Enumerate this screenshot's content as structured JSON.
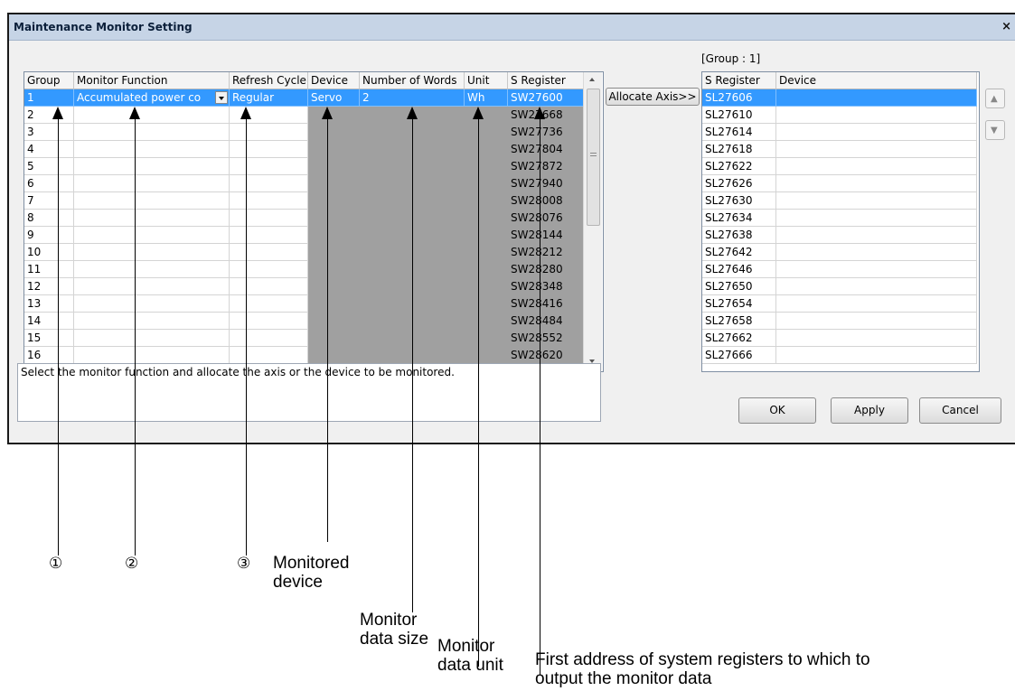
{
  "window": {
    "title": "Maintenance Monitor Setting",
    "close": "×"
  },
  "left_grid": {
    "headers": [
      "Group",
      "Monitor Function",
      "Refresh Cycle",
      "Device",
      "Number of Words",
      "Unit",
      "S Register"
    ],
    "rows": [
      [
        "1",
        "Accumulated power co",
        "Regular",
        "Servo",
        "2",
        "Wh",
        "SW27600"
      ],
      [
        "2",
        "",
        "",
        "",
        "",
        "",
        "SW27668"
      ],
      [
        "3",
        "",
        "",
        "",
        "",
        "",
        "SW27736"
      ],
      [
        "4",
        "",
        "",
        "",
        "",
        "",
        "SW27804"
      ],
      [
        "5",
        "",
        "",
        "",
        "",
        "",
        "SW27872"
      ],
      [
        "6",
        "",
        "",
        "",
        "",
        "",
        "SW27940"
      ],
      [
        "7",
        "",
        "",
        "",
        "",
        "",
        "SW28008"
      ],
      [
        "8",
        "",
        "",
        "",
        "",
        "",
        "SW28076"
      ],
      [
        "9",
        "",
        "",
        "",
        "",
        "",
        "SW28144"
      ],
      [
        "10",
        "",
        "",
        "",
        "",
        "",
        "SW28212"
      ],
      [
        "11",
        "",
        "",
        "",
        "",
        "",
        "SW28280"
      ],
      [
        "12",
        "",
        "",
        "",
        "",
        "",
        "SW28348"
      ],
      [
        "13",
        "",
        "",
        "",
        "",
        "",
        "SW28416"
      ],
      [
        "14",
        "",
        "",
        "",
        "",
        "",
        "SW28484"
      ],
      [
        "15",
        "",
        "",
        "",
        "",
        "",
        "SW28552"
      ],
      [
        "16",
        "",
        "",
        "",
        "",
        "",
        "SW28620"
      ]
    ]
  },
  "allocate_button": "Allocate Axis>>",
  "group_label": "[Group : 1]",
  "right_grid": {
    "headers": [
      "S Register",
      "Device"
    ],
    "rows": [
      [
        "SL27606",
        ""
      ],
      [
        "SL27610",
        ""
      ],
      [
        "SL27614",
        ""
      ],
      [
        "SL27618",
        ""
      ],
      [
        "SL27622",
        ""
      ],
      [
        "SL27626",
        ""
      ],
      [
        "SL27630",
        ""
      ],
      [
        "SL27634",
        ""
      ],
      [
        "SL27638",
        ""
      ],
      [
        "SL27642",
        ""
      ],
      [
        "SL27646",
        ""
      ],
      [
        "SL27650",
        ""
      ],
      [
        "SL27654",
        ""
      ],
      [
        "SL27658",
        ""
      ],
      [
        "SL27662",
        ""
      ],
      [
        "SL27666",
        ""
      ]
    ]
  },
  "move_up_icon": "move-up-icon",
  "move_down_icon": "move-down-icon",
  "description": "Select the monitor function and allocate the axis or the device to be monitored.",
  "buttons": {
    "ok": "OK",
    "apply": "Apply",
    "cancel": "Cancel"
  },
  "callouts": {
    "n1": "①",
    "n2": "②",
    "n3": "③",
    "device_l1": "Monitored",
    "device_l2": "device",
    "size_l1": "Monitor",
    "size_l2": "data size",
    "unit_l1": "Monitor",
    "unit_l2": "data unit",
    "register_l1": "First address of system registers to which to",
    "register_l2": "output the monitor data"
  },
  "colors": {
    "selection": "#3399ff",
    "disabled_cell": "#a0a0a0",
    "titlebar": "#c6d4e6"
  }
}
